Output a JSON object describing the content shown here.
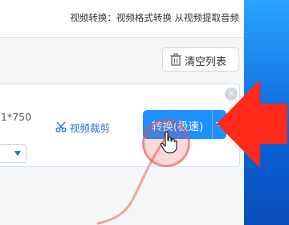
{
  "header": {
    "title": "视频转换：视频格式转换 从视频提取音频"
  },
  "toolbar": {
    "clear_list_label": "清空列表"
  },
  "file_item": {
    "resolution_text": "1*750",
    "clip_label": "视频裁剪",
    "close_symbol": "×"
  },
  "convert": {
    "label": "转换(极速)"
  },
  "colors": {
    "accent": "#1e90ff",
    "link": "#2c6fd6",
    "highlight": "#ff2a1a"
  }
}
